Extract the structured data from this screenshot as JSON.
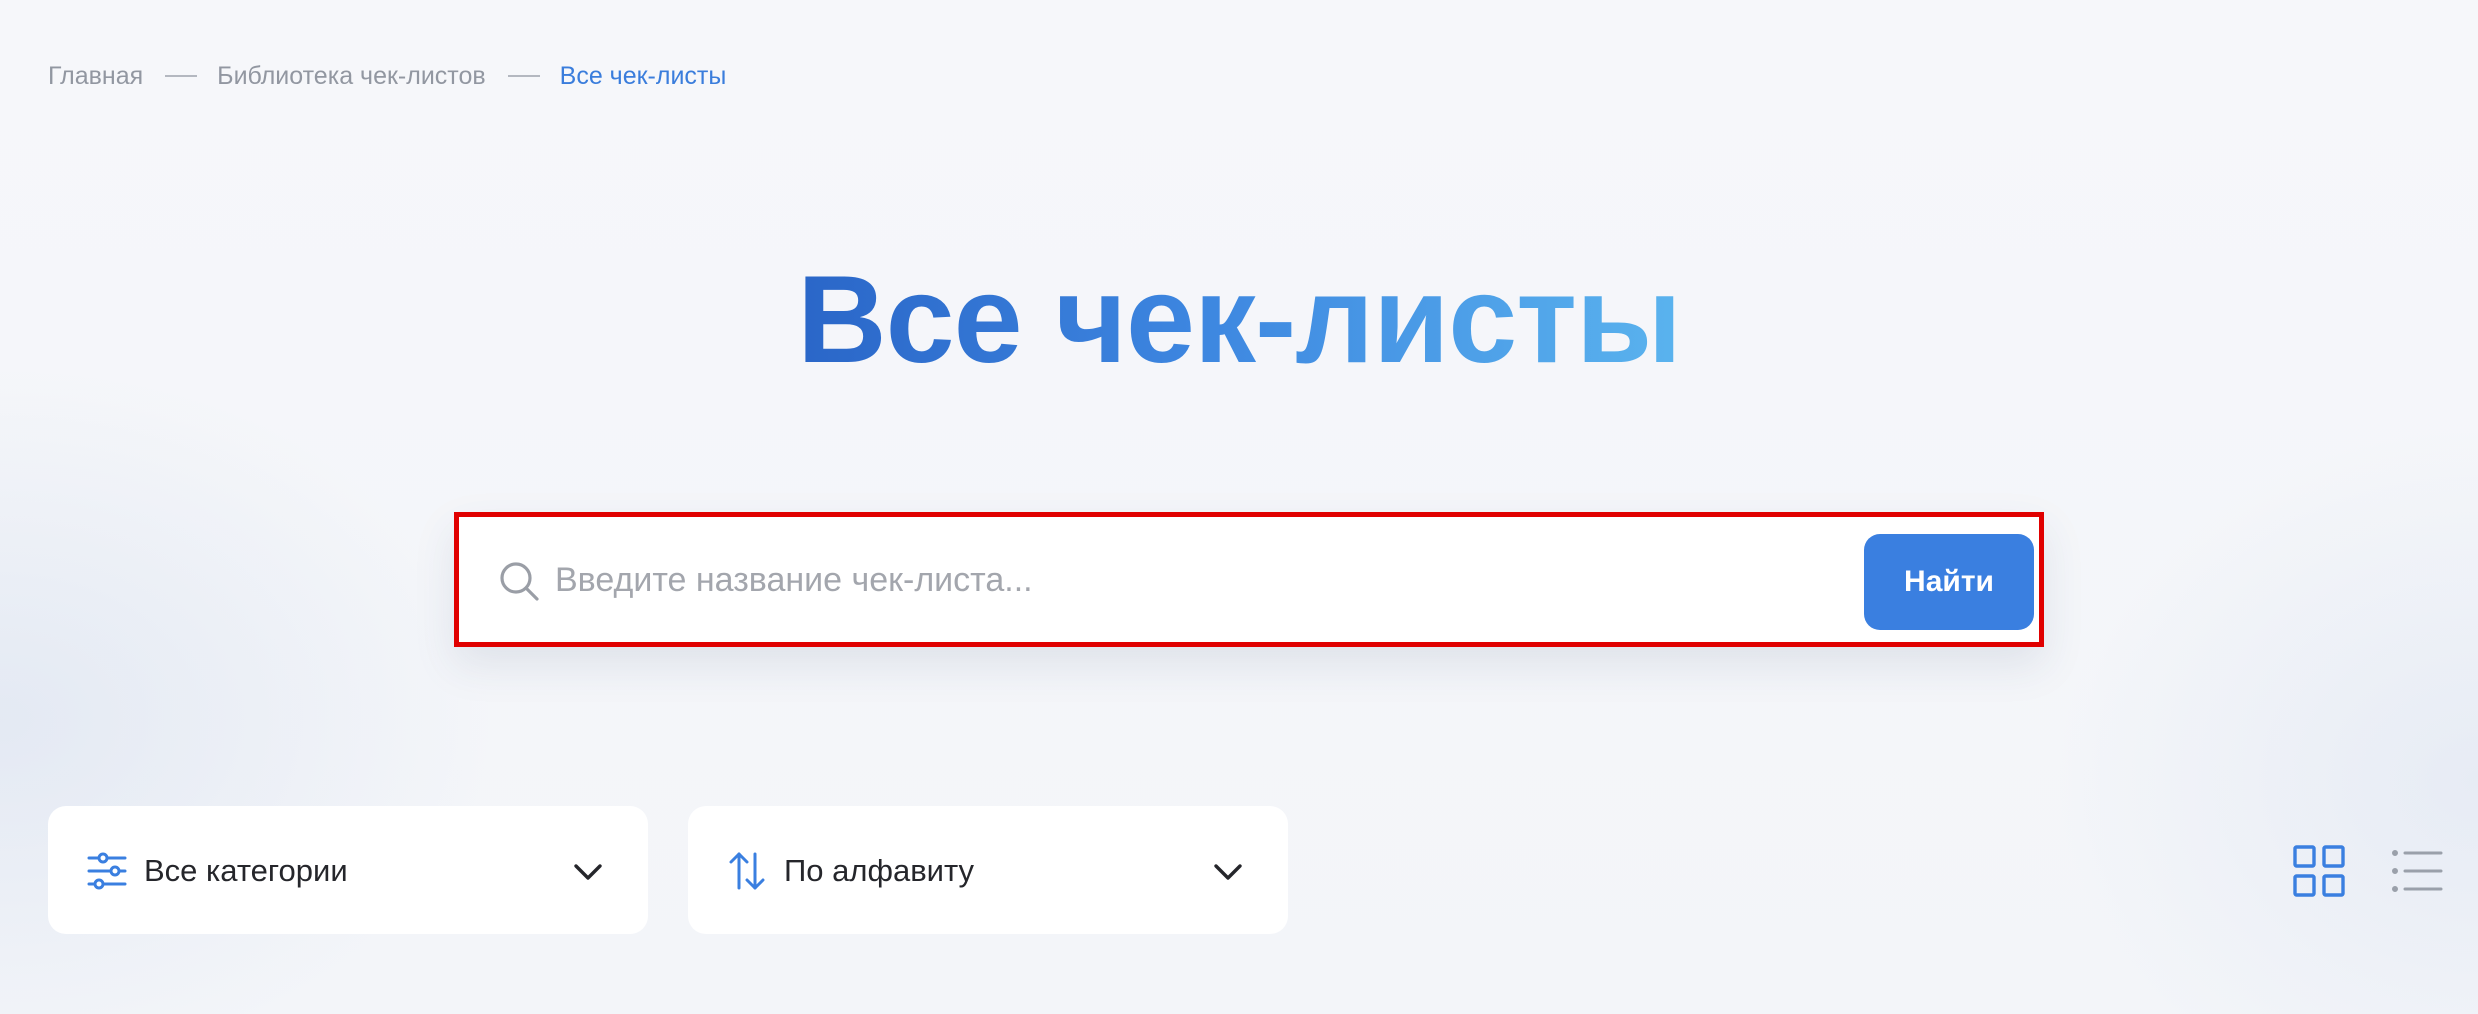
{
  "breadcrumb": {
    "home": "Главная",
    "library": "Библиотека чек-листов",
    "current": "Все чек-листы"
  },
  "page": {
    "title": "Все чек-листы"
  },
  "search": {
    "placeholder": "Введите название чек-листа...",
    "value": "",
    "button_label": "Найти",
    "icon": "search-icon"
  },
  "filters": {
    "category": {
      "label": "Все категории",
      "icon": "sliders-icon"
    },
    "sort": {
      "label": "По алфавиту",
      "icon": "sort-arrows-icon"
    }
  },
  "view": {
    "grid_icon": "grid-view-icon",
    "list_icon": "list-view-icon",
    "active": "grid"
  },
  "colors": {
    "accent": "#3a7fe0",
    "breadcrumb_current": "#3a7ddc",
    "highlight_border": "#e00000",
    "title_gradient_start": "#2a66c8",
    "title_gradient_end": "#5ab3ee"
  }
}
